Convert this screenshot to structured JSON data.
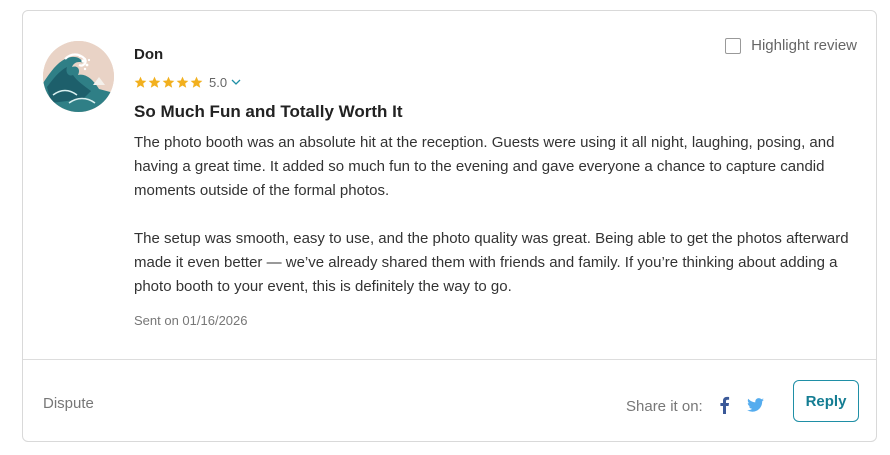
{
  "review": {
    "reviewer_name": "Don",
    "rating": 5.0,
    "rating_text": "5.0",
    "stars_filled": 5,
    "title": "So Much Fun and Totally Worth It",
    "paragraphs": [
      "The photo booth was an absolute hit at the reception. Guests were using it all night, laughing, posing, and having a great time. It added so much fun to the evening and gave everyone a chance to capture candid moments outside of the formal photos.",
      "The setup was smooth, easy to use, and the photo quality was great. Being able to get the photos afterward made it even better — we’ve already shared them with friends and family. If you’re thinking about adding a photo booth to your event, this is definitely the way to go."
    ],
    "sent_date": "Sent on 01/16/2026"
  },
  "highlight": {
    "label": "Highlight review",
    "checked": false
  },
  "footer": {
    "dispute_label": "Dispute",
    "share_label": "Share it on:",
    "reply_label": "Reply"
  },
  "icons": {
    "star": "star-icon",
    "rating_dropdown": "chevron-down-icon",
    "facebook": "facebook-icon",
    "twitter": "twitter-icon",
    "avatar": "great-wave-avatar"
  },
  "colors": {
    "star": "#f2b01e",
    "accent": "#1f8fa6",
    "facebook": "#3b5998",
    "twitter": "#55acee",
    "avatar_bg": "#e9d3c6"
  }
}
